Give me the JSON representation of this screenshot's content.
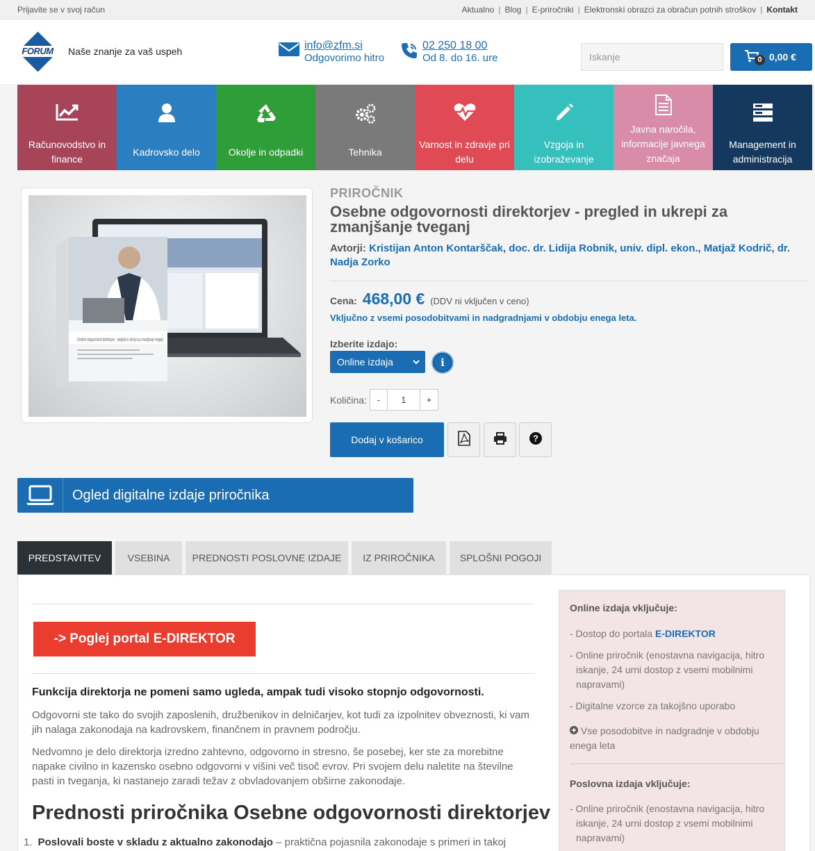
{
  "topbar": {
    "login": "Prijavite se v svoj račun",
    "links": [
      "Aktualno",
      "Blog",
      "E-priročniki",
      "Elektronski obrazci za obračun potnih stroškov"
    ],
    "contact": "Kontakt"
  },
  "header": {
    "logo_text": "FORUM",
    "slogan": "Naše znanje za vaš uspeh",
    "email": "info@zfm.si",
    "email_sub": "Odgovorimo hitro",
    "phone": "02 250 18 00",
    "phone_sub": "Od 8. do 16. ure",
    "search_placeholder": "Iskanje",
    "cart_count": "0",
    "cart_total": "0,00 €",
    "brand_color": "#1a6db3"
  },
  "categories": [
    {
      "label": "Računovodstvo in finance",
      "color": "#a84458",
      "icon": "chart-icon"
    },
    {
      "label": "Kadrovsko delo",
      "color": "#2b7fc1",
      "icon": "user-icon"
    },
    {
      "label": "Okolje in odpadki",
      "color": "#2f9e39",
      "icon": "recycle-icon"
    },
    {
      "label": "Tehnika",
      "color": "#7a7a7a",
      "icon": "gears-icon"
    },
    {
      "label": "Varnost in zdravje pri delu",
      "color": "#df4a55",
      "icon": "heartbeat-icon"
    },
    {
      "label": "Vzgoja in izobraževanje",
      "color": "#36c0bd",
      "icon": "pencil-icon"
    },
    {
      "label": "Javna naročila, informacije javnega značaja",
      "color": "#d98ca8",
      "icon": "document-icon"
    },
    {
      "label": "Management in administracija",
      "color": "#14385e",
      "icon": "server-icon"
    }
  ],
  "product": {
    "kind": "PRIROČNIK",
    "title": "Osebne odgovornosti direktorjev - pregled in ukrepi za zmanjšanje tveganj",
    "authors_label": "Avtorji:",
    "authors": [
      "Kristijan Anton Kontarščak",
      "doc. dr. Lidija Robnik, univ. dipl. ekon.",
      "Matjaž Kodrič",
      "dr. Nadja Zorko"
    ],
    "price_label": "Cena:",
    "price": "468,00 €",
    "price_note": "(DDV ni vključen v ceno)",
    "updates": "Vključno z vsemi posodobitvami in nadgradnjami v obdobju enega leta.",
    "edition_label": "Izberite izdajo:",
    "edition_value": "Online izdaja",
    "qty_label": "Količina:",
    "qty_value": "1",
    "add_label": "Dodaj v košarico",
    "cover_title": "Osebne odgovornosti direktorjev - pregled in ukrepi za zmanjšanje tveganj"
  },
  "digital": {
    "label": "Ogled digitalne izdaje priročnika"
  },
  "tabs": [
    "PREDSTAVITEV",
    "VSEBINA",
    "PREDNOSTI POSLOVNE IZDAJE",
    "IZ PRIROČNIKA",
    "SPLOŠNI POGOJI"
  ],
  "content": {
    "portal_btn": "-> Poglej portal E-DIREKTOR",
    "intro": "Funkcija direktorja ne pomeni samo ugleda, ampak tudi visoko stopnjo odgovornosti.",
    "p1": "Odgovorni ste tako do svojih zaposlenih, družbenikov in delničarjev, kot tudi za izpolnitev obveznosti, ki vam jih nalaga zakonodaja na kadrovskem, finančnem in pravnem področju.",
    "p2": "Nedvomno je delo direktorja izredno zahtevno, odgovorno in stresno, še posebej, ker ste za morebitne napake civilno in kazensko osebno odgovorni v višini več tisoč evrov. Pri svojem delu naletite na številne pasti in tveganja, ki nastanejo zaradi težav z obvladovanjem obširne zakonodaje.",
    "h2": "Prednosti priročnika Osebne odgovornosti direktorjev",
    "li_num": "1.",
    "li_bold": "Poslovali boste v skladu z aktualno zakonodajo",
    "li_text": " – praktična pojasnila zakonodaje s primeri in takoj"
  },
  "sidebar": {
    "online_title": "Online izdaja vključuje:",
    "online_items": [
      "- Dostop do portala ",
      "E-DIREKTOR",
      "- Online priročnik (enostavna navigacija, hitro iskanje, 24 urni dostop z vsemi mobilnimi napravami)",
      "- Digitalne vzorce za takojšno uporabo",
      "Vse posodobitve in nadgradnje v obdobju enega leta"
    ],
    "business_title": "Poslovna izdaja vključuje:",
    "business_items": [
      "- Online priročnik (enostavna navigacija, hitro iskanje, 24 urni dostop z vsemi mobilnimi napravami)"
    ]
  }
}
